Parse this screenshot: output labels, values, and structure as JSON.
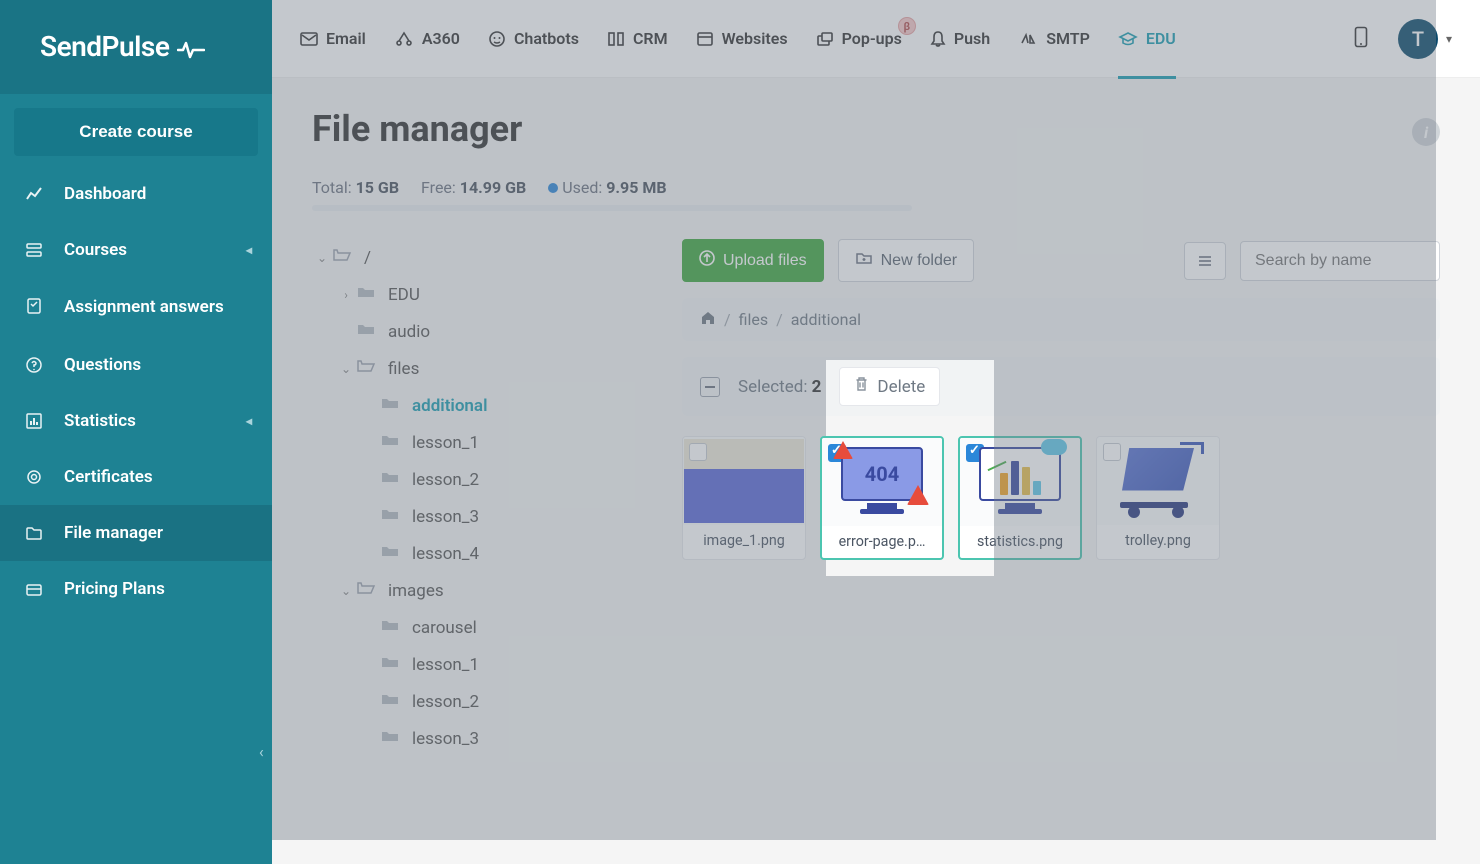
{
  "brand": "SendPulse",
  "sidebar": {
    "create_label": "Create course",
    "items": [
      {
        "label": "Dashboard"
      },
      {
        "label": "Courses",
        "caret": true
      },
      {
        "label": "Assignment answers"
      },
      {
        "label": "Questions"
      },
      {
        "label": "Statistics",
        "caret": true
      },
      {
        "label": "Certificates"
      },
      {
        "label": "File manager",
        "active": true
      },
      {
        "label": "Pricing Plans"
      }
    ]
  },
  "topnav": {
    "items": [
      {
        "label": "Email"
      },
      {
        "label": "A360"
      },
      {
        "label": "Chatbots"
      },
      {
        "label": "CRM"
      },
      {
        "label": "Websites"
      },
      {
        "label": "Pop-ups",
        "beta": "β"
      },
      {
        "label": "Push"
      },
      {
        "label": "SMTP"
      },
      {
        "label": "EDU",
        "active": true
      }
    ],
    "avatar_initial": "T"
  },
  "page": {
    "title": "File manager",
    "storage": {
      "total_label": "Total:",
      "total_value": "15 GB",
      "free_label": "Free:",
      "free_value": "14.99 GB",
      "used_label": "Used:",
      "used_value": "9.95 MB"
    },
    "toolbar": {
      "upload_label": "Upload files",
      "new_folder_label": "New folder",
      "search_placeholder": "Search by name"
    },
    "breadcrumb": {
      "parts": [
        "files",
        "additional"
      ]
    },
    "selection": {
      "label": "Selected:",
      "count": "2",
      "delete_label": "Delete"
    },
    "tree": [
      {
        "label": "/",
        "indent": 0,
        "open": true
      },
      {
        "label": "EDU",
        "indent": 1,
        "collapsed": true
      },
      {
        "label": "audio",
        "indent": 1
      },
      {
        "label": "files",
        "indent": 1,
        "open": true
      },
      {
        "label": "additional",
        "indent": 2,
        "active": true
      },
      {
        "label": "lesson_1",
        "indent": 2
      },
      {
        "label": "lesson_2",
        "indent": 2
      },
      {
        "label": "lesson_3",
        "indent": 2
      },
      {
        "label": "lesson_4",
        "indent": 2
      },
      {
        "label": "images",
        "indent": 1,
        "open": true
      },
      {
        "label": "carousel",
        "indent": 2
      },
      {
        "label": "lesson_1",
        "indent": 2
      },
      {
        "label": "lesson_2",
        "indent": 2
      },
      {
        "label": "lesson_3",
        "indent": 2
      }
    ],
    "files": [
      {
        "name": "image_1.png",
        "selected": false
      },
      {
        "name": "error-page.p…",
        "selected": true
      },
      {
        "name": "statistics.png",
        "selected": true
      },
      {
        "name": "trolley.png",
        "selected": false
      }
    ]
  }
}
